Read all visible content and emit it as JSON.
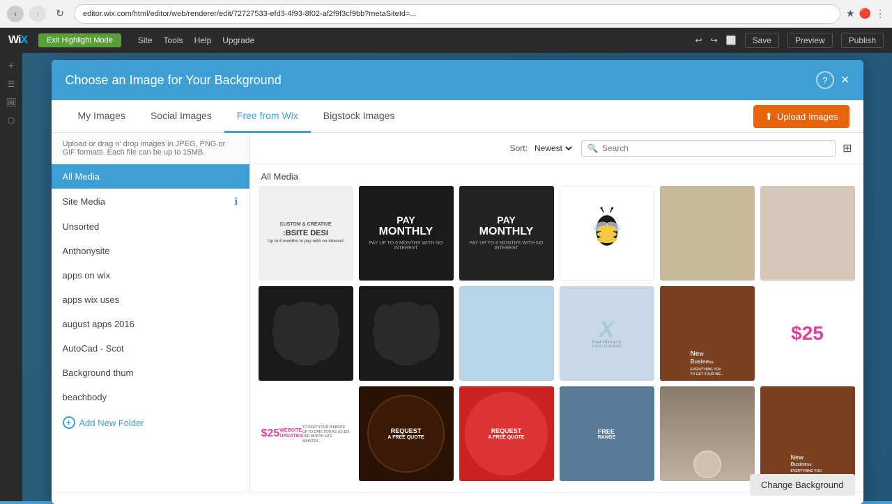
{
  "browser": {
    "url": "editor.wix.com/html/editor/web/renderer/edit/72727533-efd3-4f93-8f02-af2f9f3cf9bb?metaSiteId=...",
    "back_disabled": false,
    "forward_disabled": false
  },
  "editor": {
    "logo": "WiX",
    "mode_button": "Exit Highlight Mode",
    "menu_items": [
      "Site",
      "Tools",
      "Help",
      "Upgrade"
    ],
    "right_actions": [
      "undo",
      "redo",
      "device_toggle",
      "save",
      "preview",
      "publish"
    ],
    "save_label": "Save",
    "preview_label": "Preview",
    "publish_label": "Publish"
  },
  "modal": {
    "title": "Choose an Image for Your Background",
    "help_label": "?",
    "close_label": "×",
    "tabs": [
      {
        "id": "my-images",
        "label": "My Images"
      },
      {
        "id": "social-images",
        "label": "Social Images"
      },
      {
        "id": "free-from-wix",
        "label": "Free from Wix",
        "active": true
      },
      {
        "id": "bigstock-images",
        "label": "Bigstock Images"
      }
    ],
    "upload_button": "Upload Images",
    "upload_hint": "Upload or drag n' drop images in JPEG, PNG or GIF formats. Each file can be up to 15MB.",
    "sort_label": "Sort:",
    "sort_value": "Newest",
    "search_placeholder": "Search",
    "grid_view_icon": "⊞"
  },
  "sidebar": {
    "items": [
      {
        "id": "all-media",
        "label": "All Media",
        "active": true
      },
      {
        "id": "site-media",
        "label": "Site Media",
        "has_info": true
      },
      {
        "id": "unsorted",
        "label": "Unsorted"
      },
      {
        "id": "anthonysite",
        "label": "Anthonysite"
      },
      {
        "id": "apps-on-wix",
        "label": "apps on wix"
      },
      {
        "id": "apps-wix-uses",
        "label": "apps wix uses"
      },
      {
        "id": "august-apps-2016",
        "label": "august apps 2016"
      },
      {
        "id": "autocad-scot",
        "label": "AutoCad - Scot"
      },
      {
        "id": "background-thum",
        "label": "Background thum"
      },
      {
        "id": "beachbody",
        "label": "beachbody"
      }
    ],
    "add_folder_label": "Add New Folder"
  },
  "content": {
    "section_label": "All Media",
    "images": [
      {
        "id": "img1",
        "type": "website-desi",
        "alt": "Custom Creative Website Design"
      },
      {
        "id": "img2",
        "type": "pay-monthly-dark",
        "alt": "Pay Monthly dark"
      },
      {
        "id": "img3",
        "type": "pay-monthly-light",
        "alt": "Pay Monthly light"
      },
      {
        "id": "img4",
        "type": "bee",
        "alt": "Bee illustration"
      },
      {
        "id": "img5",
        "type": "tan",
        "alt": "Tan texture"
      },
      {
        "id": "img6",
        "type": "linen",
        "alt": "Linen texture"
      },
      {
        "id": "img7",
        "type": "black-badge",
        "alt": "Black badge shape"
      },
      {
        "id": "img8",
        "type": "black-badge-2",
        "alt": "Black badge shape 2"
      },
      {
        "id": "img9",
        "type": "light-blue",
        "alt": "Light blue"
      },
      {
        "id": "img10",
        "type": "xtraordinary",
        "alt": "Xtraordinary event planning"
      },
      {
        "id": "img11",
        "type": "new-business",
        "alt": "New Business"
      },
      {
        "id": "img12",
        "type": "25-pink",
        "alt": "$25 website updates"
      },
      {
        "id": "img13",
        "type": "25-updates",
        "alt": "$25 website updates small"
      },
      {
        "id": "img14",
        "type": "request-dark",
        "alt": "Request a free quote dark"
      },
      {
        "id": "img15",
        "type": "request-red",
        "alt": "Request a free quote red"
      },
      {
        "id": "img16",
        "type": "free-range",
        "alt": "Free Range"
      },
      {
        "id": "img17",
        "type": "portrait",
        "alt": "Portrait photo"
      },
      {
        "id": "img18",
        "type": "new-biz-2",
        "alt": "New Business 2"
      }
    ],
    "change_bg_label": "Change Background"
  }
}
